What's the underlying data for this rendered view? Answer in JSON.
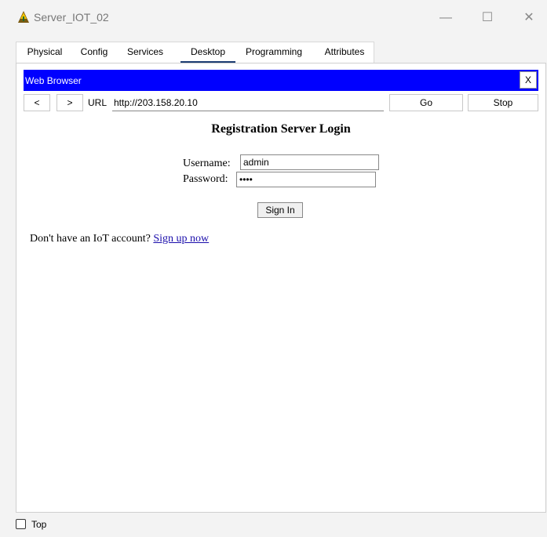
{
  "window": {
    "title": "Server_IOT_02",
    "minimize_glyph": "—",
    "maximize_glyph": "☐",
    "close_glyph": "✕"
  },
  "tabs": [
    {
      "label": "Physical"
    },
    {
      "label": "Config"
    },
    {
      "label": "Services"
    },
    {
      "label": "Desktop",
      "active": true
    },
    {
      "label": "Programming"
    },
    {
      "label": "Attributes"
    }
  ],
  "browser": {
    "title": "Web Browser",
    "close_label": "X",
    "back_label": "<",
    "forward_label": ">",
    "url_label": "URL",
    "url_value": "http://203.158.20.10",
    "go_label": "Go",
    "stop_label": "Stop"
  },
  "page": {
    "heading": "Registration Server Login",
    "username_label": "Username:",
    "username_value": "admin",
    "password_label": "Password:",
    "password_value": "••••",
    "signin_label": "Sign In",
    "signup_prompt": "Don't have an IoT account?",
    "signup_link": "Sign up now"
  },
  "footer": {
    "top_label": "Top",
    "top_checked": false
  }
}
